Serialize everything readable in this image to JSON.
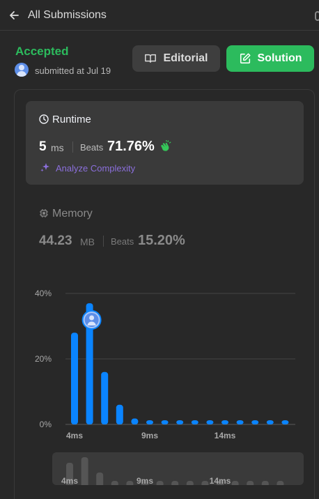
{
  "header": {
    "back_label": "All Submissions"
  },
  "submission": {
    "status": "Accepted",
    "status_color": "#2cbb5d",
    "submitted_text": "submitted at Jul 19"
  },
  "buttons": {
    "editorial": "Editorial",
    "solution": "Solution"
  },
  "runtime": {
    "label": "Runtime",
    "value": "5",
    "unit": "ms",
    "beats_label": "Beats",
    "beats": "71.76%",
    "analyze_label": "Analyze Complexity"
  },
  "memory": {
    "label": "Memory",
    "value": "44.23",
    "unit": "MB",
    "beats_label": "Beats",
    "beats": "15.20%"
  },
  "chart_data": {
    "type": "bar",
    "y_ticks": [
      "40%",
      "20%",
      "0%"
    ],
    "ylim": [
      0,
      40
    ],
    "x_tick_labels": [
      "4ms",
      "9ms",
      "14ms"
    ],
    "values": [
      28,
      37,
      16,
      6,
      1.8,
      1,
      1,
      1,
      1,
      1,
      1,
      1,
      1,
      1,
      1
    ],
    "highlight_index": 1,
    "bar_color": "#0a84ff"
  },
  "mini_chart": {
    "values": [
      32,
      40,
      18,
      6,
      6,
      6,
      6,
      6,
      6,
      6,
      6,
      6,
      6,
      6,
      6
    ],
    "x_tick_labels": [
      "4ms",
      "9ms",
      "14ms"
    ]
  }
}
